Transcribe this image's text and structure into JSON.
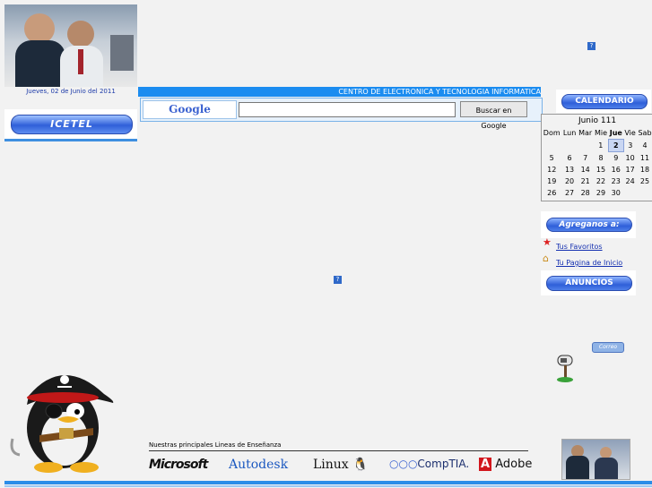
{
  "left": {
    "date": "Jueves, 02 de Junio del 2011",
    "icetel_label": "ICETEL"
  },
  "header": {
    "banner_title": "CENTRO DE ELECTRONICA Y TECNOLOGIA INFORMATICA",
    "help_glyph": "?"
  },
  "search": {
    "logo_text": "Google",
    "button_label": "Buscar en Google",
    "value": ""
  },
  "calendar": {
    "header_label": "CALENDARIO",
    "month_title": "Junio 111",
    "weekdays": [
      "Dom",
      "Lun",
      "Mar",
      "Mie",
      "Jue",
      "Vie",
      "Sab"
    ],
    "weeks": [
      [
        "",
        "",
        "",
        "1",
        "2",
        "3",
        "4"
      ],
      [
        "5",
        "6",
        "7",
        "8",
        "9",
        "10",
        "11"
      ],
      [
        "12",
        "13",
        "14",
        "15",
        "16",
        "17",
        "18"
      ],
      [
        "19",
        "20",
        "21",
        "22",
        "23",
        "24",
        "25"
      ],
      [
        "26",
        "27",
        "28",
        "29",
        "30",
        "",
        ""
      ]
    ],
    "today": "2"
  },
  "sidebar": {
    "agreganos_label": "Agreganos a:",
    "favoritos_label": "Tus Favoritos",
    "inicio_label": "Tu Pagina de Inicio",
    "anuncios_label": "ANUNCIOS",
    "correo_label": "Correo"
  },
  "footer": {
    "lines_label": "Nuestras principales Lineas de Enseñanza",
    "logos": [
      "Microsoft",
      "Autodesk",
      "Linux",
      "CompTIA.",
      "Adobe"
    ]
  },
  "colors": {
    "banner": "#1b8cf0",
    "button": "#2f5fd9",
    "link": "#1530b0"
  }
}
